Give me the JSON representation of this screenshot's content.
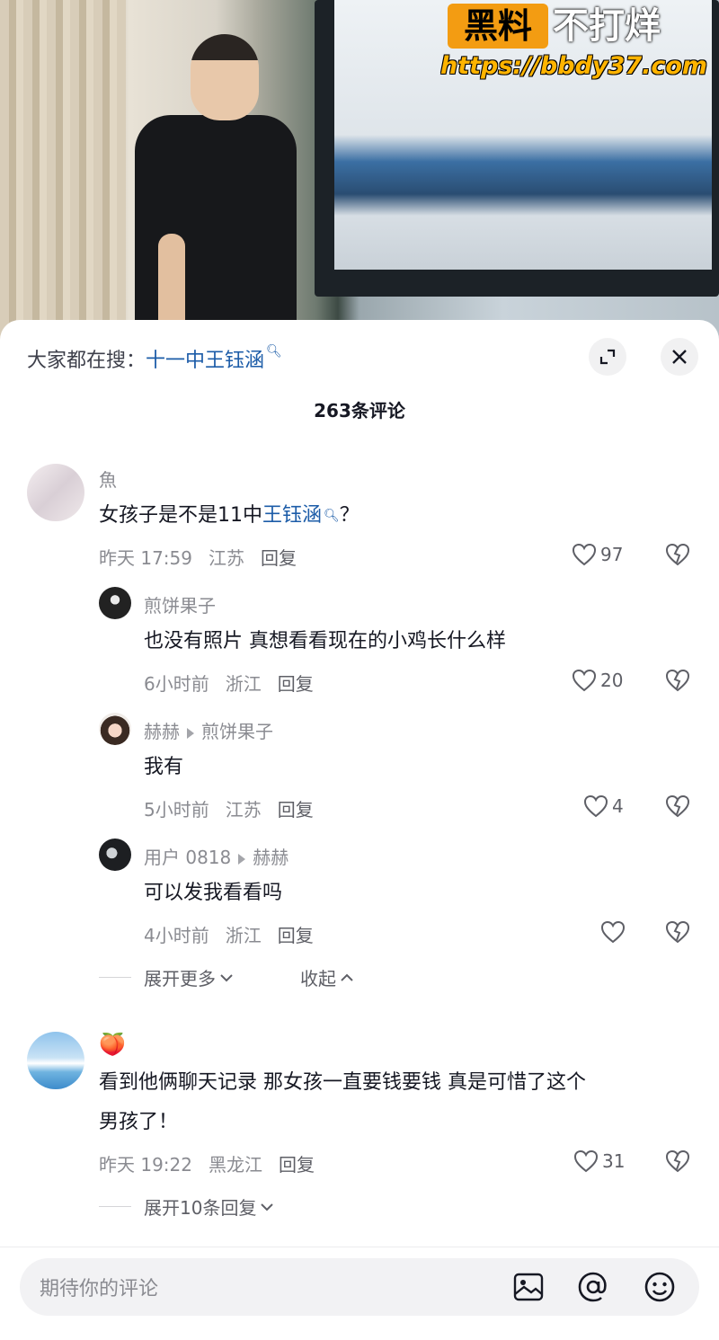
{
  "watermark": {
    "badge": "黑料",
    "text": "不打烊",
    "url": "https://bbdy37.com"
  },
  "search": {
    "prefix": "大家都在搜：",
    "term": "十一中王钰涵"
  },
  "comment_count": "263条评论",
  "comments": [
    {
      "name": "魚",
      "text_before": "女孩子是不是11中",
      "highlight": "王钰涵",
      "text_after": "？",
      "time": "昨天 17:59",
      "location": "江苏",
      "reply_label": "回复",
      "likes": "97",
      "replies": [
        {
          "name": "煎饼果子",
          "reply_to": "",
          "text": "也没有照片 真想看看现在的小鸡长什么样",
          "time": "6小时前",
          "location": "浙江",
          "reply_label": "回复",
          "likes": "20"
        },
        {
          "name": "赫赫",
          "reply_to": "煎饼果子",
          "text": "我有",
          "time": "5小时前",
          "location": "江苏",
          "reply_label": "回复",
          "likes": "4"
        },
        {
          "name": "用户 0818",
          "reply_to": "赫赫",
          "text": "可以发我看看吗",
          "time": "4小时前",
          "location": "浙江",
          "reply_label": "回复",
          "likes": ""
        }
      ],
      "expand_more": "展开更多",
      "collapse": "收起"
    },
    {
      "name": "🍑",
      "text_line1": "看到他俩聊天记录 那女孩一直要钱要钱 真是可惜了这个",
      "text_line2": "男孩了！",
      "time": "昨天 19:22",
      "location": "黑龙江",
      "reply_label": "回复",
      "likes": "31",
      "expand_replies": "展开10条回复"
    }
  ],
  "input": {
    "placeholder": "期待你的评论"
  },
  "icons": {
    "expand": "expand-icon",
    "close": "close-icon",
    "image": "image-icon",
    "at": "at-icon",
    "emoji": "emoji-icon",
    "heart": "heart-icon",
    "dislike": "broken-heart-icon"
  }
}
